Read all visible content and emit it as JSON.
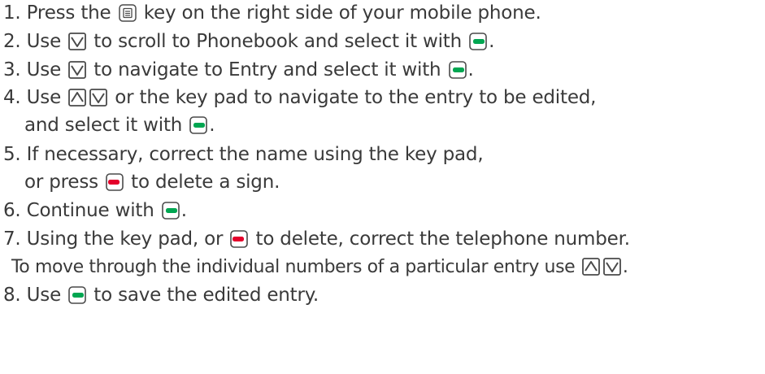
{
  "steps": [
    {
      "num": "1.",
      "text_a": "Press the",
      "icon_a": "menu-key-icon",
      "text_b": "key on the right side of your mobile phone."
    },
    {
      "num": "2.",
      "text_a": "Use",
      "icon_a": "down-arrow-key-icon",
      "text_b": "to scroll to Phonebook and select it with",
      "icon_b": "green-softkey-icon",
      "text_c": "."
    },
    {
      "num": "3.",
      "text_a": "Use",
      "icon_a": "down-arrow-key-icon",
      "text_b": "to navigate to Entry and select it with",
      "icon_b": "green-softkey-icon",
      "text_c": "."
    },
    {
      "num": "4.",
      "text_a": "Use",
      "icon_a": "up-arrow-key-icon",
      "icon_a2": "down-arrow-key-icon",
      "text_b": "or the key pad to navigate to the entry to be edited,",
      "cont_text_a": "and select it with",
      "cont_icon": "green-softkey-icon",
      "cont_text_b": "."
    },
    {
      "num": "5.",
      "text_a": "If necessary, correct the name using the key pad,",
      "cont_text_a": "or press",
      "cont_icon": "red-softkey-icon",
      "cont_text_b": "to delete a sign."
    },
    {
      "num": "6.",
      "text_a": "Continue with",
      "icon_a": "green-softkey-icon",
      "text_b": "."
    },
    {
      "num": "7.",
      "text_a": "Using the key pad, or",
      "icon_a": "red-softkey-icon",
      "text_b": "to delete, correct the telephone number.",
      "cont_text_a": "To move through the individual numbers of a particular entry use",
      "cont_icon": "up-arrow-key-icon",
      "cont_icon2": "down-arrow-key-icon",
      "cont_text_b": "."
    },
    {
      "num": "8.",
      "text_a": "Use",
      "icon_a": "green-softkey-icon",
      "text_b": "to save the edited entry."
    }
  ],
  "colors": {
    "text": "#3a3a3a",
    "key_border": "#4a4a4a",
    "green_accent": "#00a651",
    "red_accent": "#e4002b"
  }
}
